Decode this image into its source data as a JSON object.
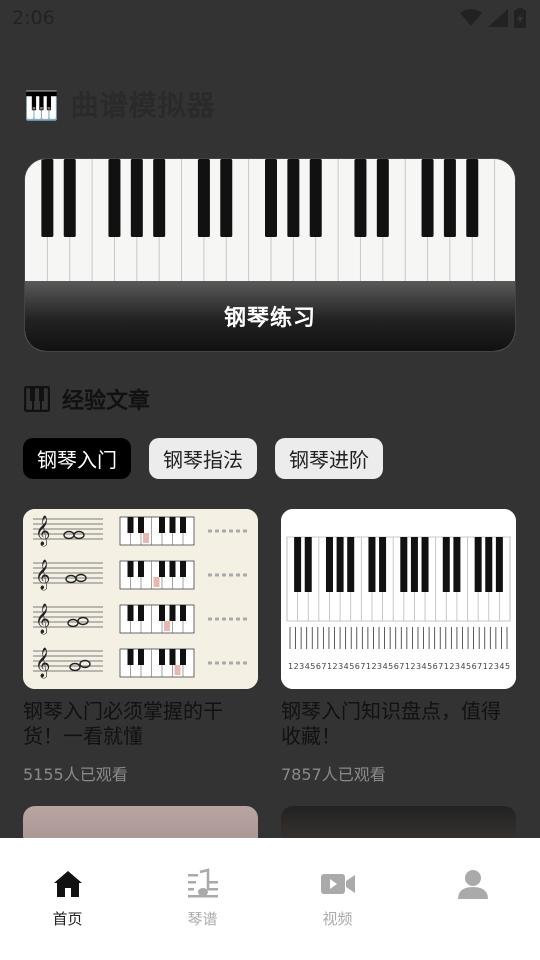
{
  "status_bar": {
    "time": "2:06"
  },
  "app": {
    "title": "🎹 曲谱模拟器"
  },
  "hero": {
    "label": "钢琴练习"
  },
  "section": {
    "title": "经验文章"
  },
  "tabs": [
    {
      "label": "钢琴入门",
      "active": true
    },
    {
      "label": "钢琴指法",
      "active": false
    },
    {
      "label": "钢琴进阶",
      "active": false
    }
  ],
  "articles": [
    {
      "title": "钢琴入门必须掌握的干货！一看就懂",
      "views": "5155人已观看"
    },
    {
      "title": "钢琴入门知识盘点，值得收藏！",
      "views": "7857人已观看"
    }
  ],
  "nav": [
    {
      "label": "首页",
      "icon": "home-icon",
      "active": true
    },
    {
      "label": "琴谱",
      "icon": "sheet-music-icon",
      "active": false
    },
    {
      "label": "视频",
      "icon": "video-icon",
      "active": false
    },
    {
      "label": "",
      "icon": "user-icon",
      "active": false
    }
  ],
  "colors": {
    "background": "#333333",
    "accent": "#000000",
    "nav_bg": "#ffffff"
  }
}
